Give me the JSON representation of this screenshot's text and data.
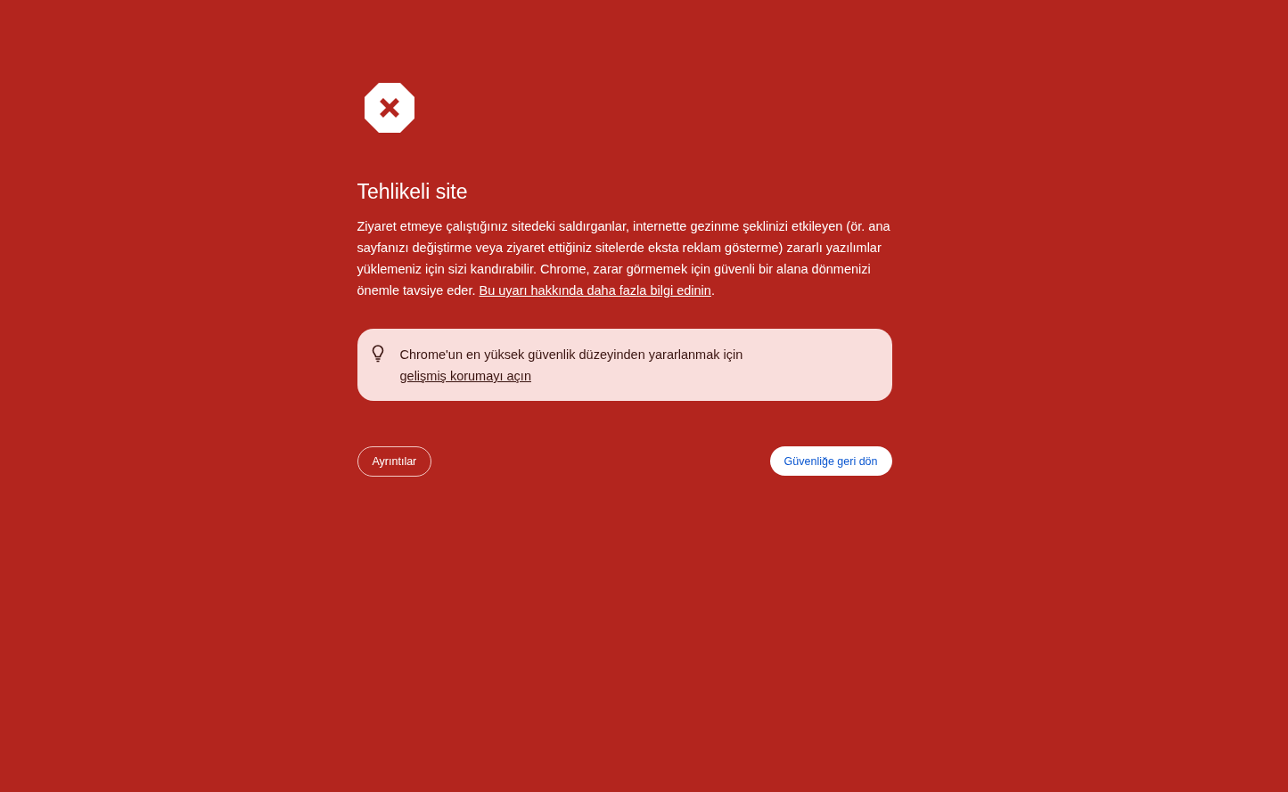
{
  "heading": "Tehlikeli site",
  "description": {
    "text": "Ziyaret etmeye çalıştığınız sitedeki saldırganlar, internette gezinme şeklinizi etkileyen (ör. ana sayfanızı değiştirme veya ziyaret ettiğiniz sitelerde eksta reklam gösterme) zararlı yazılımlar yüklemeniz için sizi kandırabilir. Chrome, zarar görmemek için güvenli bir alana dönmenizi önemle tavsiye eder. ",
    "link": "Bu uyarı hakkında daha fazla bilgi edinin",
    "after": "."
  },
  "tip": {
    "text": "Chrome'un en yüksek güvenlik düzeyinden yararlanmak için ",
    "link": "gelişmiş korumayı açın"
  },
  "buttons": [
    {
      "label": "Ayrıntılar",
      "kind": "outline"
    },
    {
      "label": "Güvenliğe geri dön",
      "kind": "primary"
    }
  ]
}
